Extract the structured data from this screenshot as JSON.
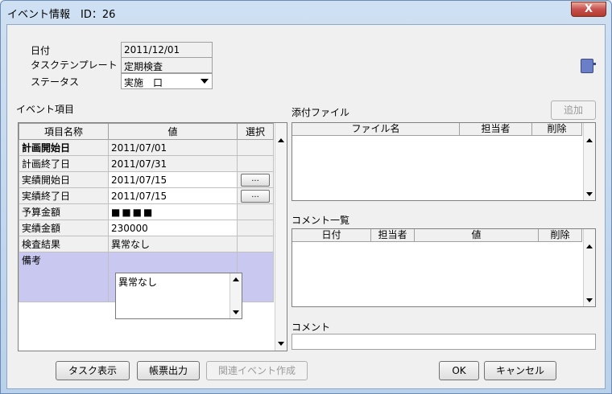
{
  "window": {
    "title": "イベント情報　ID：26",
    "close_label": "X"
  },
  "header": {
    "date_label": "日付",
    "date_value": "2011/12/01",
    "template_label": "タスクテンプレート",
    "template_value": "定期検査",
    "status_label": "ステータス",
    "status_value": "実施　口"
  },
  "event_items": {
    "section_label": "イベント項目",
    "columns": [
      "項目名称",
      "値",
      "選択"
    ],
    "rows": [
      {
        "name": "計画開始日",
        "value": "2011/07/01"
      },
      {
        "name": "計画終了日",
        "value": "2011/07/31"
      },
      {
        "name": "実績開始日",
        "value": "2011/07/15",
        "picker": "..."
      },
      {
        "name": "実績終了日",
        "value": "2011/07/15",
        "picker": "..."
      },
      {
        "name": "予算金額",
        "value": "■■■■"
      },
      {
        "name": "実績金額",
        "value": "230000"
      },
      {
        "name": "検査結果",
        "value": "異常なし"
      },
      {
        "name": "備考",
        "value": "異常なし"
      }
    ]
  },
  "attachments": {
    "section_label": "添付ファイル",
    "add_button": "追加",
    "columns": [
      "ファイル名",
      "担当者",
      "削除"
    ]
  },
  "comments": {
    "section_label": "コメント一覧",
    "columns": [
      "日付",
      "担当者",
      "値",
      "削除"
    ],
    "input_label": "コメント"
  },
  "buttons": {
    "task_display": "タスク表示",
    "report_output": "帳票出力",
    "related_event": "関連イベント作成",
    "ok": "OK",
    "cancel": "キャンセル"
  }
}
